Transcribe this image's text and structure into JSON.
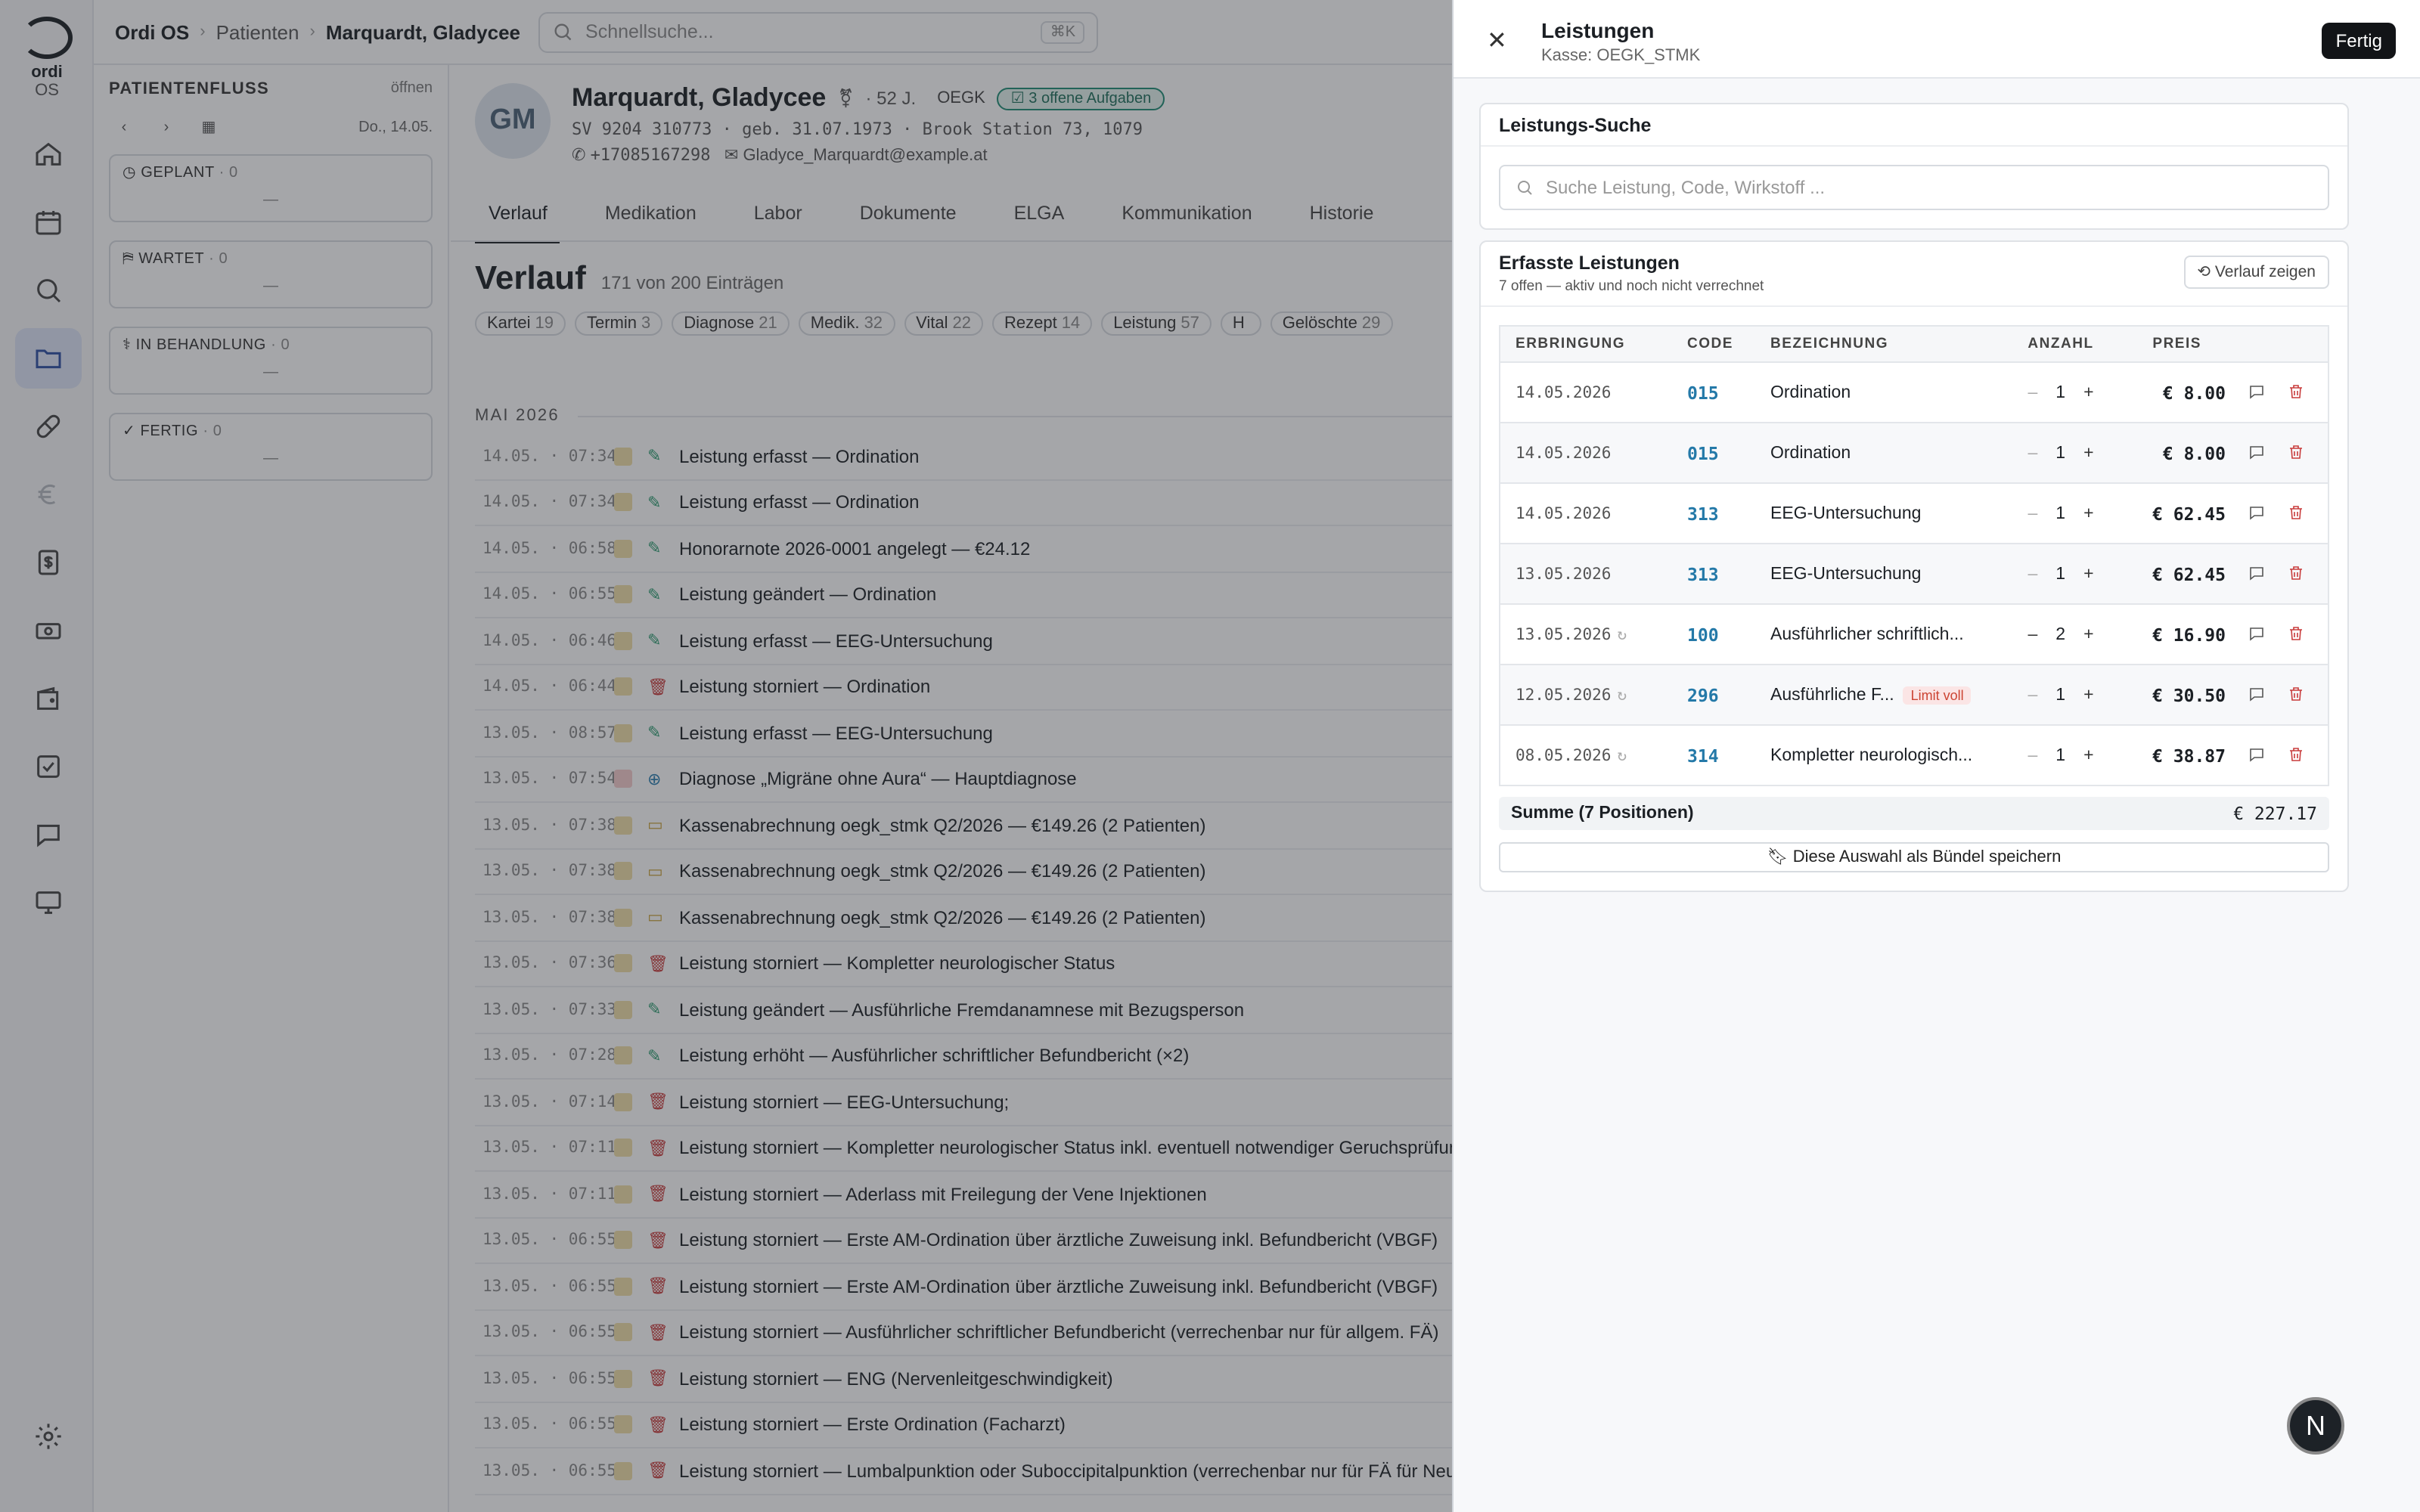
{
  "app": {
    "logo_text": "ordi",
    "logo_suffix": "OS",
    "name": "Ordi OS"
  },
  "breadcrumb": {
    "section": "Patienten",
    "current": "Marquardt, Gladycee"
  },
  "search": {
    "placeholder": "Schnellsuche...",
    "shortcut": "⌘K"
  },
  "rail_icons": [
    "home-icon",
    "calendar-icon",
    "search-icon",
    "folder-icon",
    "pill-icon",
    "euro-icon",
    "dollar-doc-icon",
    "banknote-icon",
    "wallet-icon",
    "checkbox-icon",
    "chat-icon",
    "monitor-icon",
    "gear-icon"
  ],
  "flow": {
    "title": "PATIENTENFLUSS",
    "open_label": "öffnen",
    "date": "Do., 14.05.",
    "boxes": [
      {
        "label": "GEPLANT",
        "count": "· 0",
        "empty": "—"
      },
      {
        "label": "WARTET",
        "count": "· 0",
        "empty": "—"
      },
      {
        "label": "IN BEHANDLUNG",
        "count": "· 0",
        "empty": "—"
      },
      {
        "label": "FERTIG",
        "count": "· 0",
        "empty": "—"
      }
    ]
  },
  "patient": {
    "initials": "GM",
    "name": "Marquardt, Gladycee",
    "meta": "· 52 J.",
    "insurance": "OEGK",
    "tasks": "3 offene Aufgaben",
    "line1": "SV 9204 310773 · geb. 31.07.1973 · Brook Station 73, 1079",
    "phone": "+17085167298",
    "email": "Gladyce_Marquardt@example.at"
  },
  "tabs": [
    "Verlauf",
    "Medikation",
    "Labor",
    "Dokumente",
    "ELGA",
    "Kommunikation",
    "Historie"
  ],
  "verlauf": {
    "title": "Verlauf",
    "count": "171 von 200 Einträgen",
    "chips": [
      {
        "label": "Kartei",
        "n": "19"
      },
      {
        "label": "Termin",
        "n": "3"
      },
      {
        "label": "Diagnose",
        "n": "21"
      },
      {
        "label": "Medik.",
        "n": "32"
      },
      {
        "label": "Vital",
        "n": "22"
      },
      {
        "label": "Rezept",
        "n": "14"
      },
      {
        "label": "Leistung",
        "n": "57"
      },
      {
        "label": "H",
        "n": ""
      },
      {
        "label": "Gelöschte",
        "n": "29"
      }
    ],
    "month": "MAI 2026",
    "entries": [
      {
        "ts": "14.05. · 07:34",
        "text": "Leistung erfasst — Ordination",
        "kind": "edit"
      },
      {
        "ts": "14.05. · 07:34",
        "text": "Leistung erfasst — Ordination",
        "kind": "edit"
      },
      {
        "ts": "14.05. · 06:58",
        "text": "Honorarnote 2026-0001 angelegt — €24.12",
        "kind": "edit"
      },
      {
        "ts": "14.05. · 06:55",
        "text": "Leistung geändert — Ordination",
        "kind": "edit"
      },
      {
        "ts": "14.05. · 06:46",
        "text": "Leistung erfasst — EEG-Untersuchung",
        "kind": "edit"
      },
      {
        "ts": "14.05. · 06:44",
        "text": "Leistung storniert — Ordination",
        "kind": "del"
      },
      {
        "ts": "13.05. · 08:57",
        "text": "Leistung erfasst — EEG-Untersuchung",
        "kind": "edit"
      },
      {
        "ts": "13.05. · 07:54",
        "text": "Diagnose „Migräne ohne Aura“ — Hauptdiagnose",
        "kind": "diag"
      },
      {
        "ts": "13.05. · 07:38",
        "text": "Kassenabrechnung oegk_stmk Q2/2026 — €149.26 (2 Patienten)",
        "kind": "bill"
      },
      {
        "ts": "13.05. · 07:38",
        "text": "Kassenabrechnung oegk_stmk Q2/2026 — €149.26 (2 Patienten)",
        "kind": "bill"
      },
      {
        "ts": "13.05. · 07:38",
        "text": "Kassenabrechnung oegk_stmk Q2/2026 — €149.26 (2 Patienten)",
        "kind": "bill"
      },
      {
        "ts": "13.05. · 07:36",
        "text": "Leistung storniert — Kompletter neurologischer Status",
        "kind": "del"
      },
      {
        "ts": "13.05. · 07:33",
        "text": "Leistung geändert — Ausführliche Fremdanamnese mit Bezugsperson",
        "kind": "edit"
      },
      {
        "ts": "13.05. · 07:28",
        "text": "Leistung erhöht — Ausführlicher schriftlicher Befundbericht (×2)",
        "kind": "edit"
      },
      {
        "ts": "13.05. · 07:14",
        "text": "Leistung storniert — EEG-Untersuchung;",
        "kind": "del"
      },
      {
        "ts": "13.05. · 07:11",
        "text": "Leistung storniert — Kompletter neurologischer Status inkl. eventuell notwendiger Geruchsprüfung",
        "kind": "del"
      },
      {
        "ts": "13.05. · 07:11",
        "text": "Leistung storniert — Aderlass mit Freilegung der Vene Injektionen",
        "kind": "del"
      },
      {
        "ts": "13.05. · 06:55",
        "text": "Leistung storniert — Erste AM-Ordination über ärztliche Zuweisung inkl. Befundbericht (VBGF)",
        "kind": "del"
      },
      {
        "ts": "13.05. · 06:55",
        "text": "Leistung storniert — Erste AM-Ordination über ärztliche Zuweisung inkl. Befundbericht (VBGF)",
        "kind": "del"
      },
      {
        "ts": "13.05. · 06:55",
        "text": "Leistung storniert — Ausführlicher schriftlicher Befundbericht (verrechenbar nur für allgem. FÄ)",
        "kind": "del"
      },
      {
        "ts": "13.05. · 06:55",
        "text": "Leistung storniert — ENG (Nervenleitgeschwindigkeit)",
        "kind": "del"
      },
      {
        "ts": "13.05. · 06:55",
        "text": "Leistung storniert — Erste Ordination (Facharzt)",
        "kind": "del"
      },
      {
        "ts": "13.05. · 06:55",
        "text": "Leistung storniert — Lumbalpunktion oder Suboccipitalpunktion (verrechenbar nur für FÄ für Neurologie)",
        "kind": "del"
      }
    ]
  },
  "panel": {
    "title": "Leistungen",
    "subtitle": "Kasse: OEGK_STMK",
    "done": "Fertig",
    "search_title": "Leistungs-Suche",
    "search_placeholder": "Suche Leistung, Code, Wirkstoff ...",
    "list_title": "Erfasste Leistungen",
    "list_sub": "7 offen — aktiv und noch nicht verrechnet",
    "history_btn": "Verlauf zeigen",
    "columns": [
      "ERBRINGUNG",
      "CODE",
      "BEZEICHNUNG",
      "ANZAHL",
      "PREIS"
    ],
    "rows": [
      {
        "date": "14.05.2026",
        "rep": "",
        "code": "015",
        "name": "Ordination",
        "limit": "",
        "qty": "1",
        "price": "€ 8.00"
      },
      {
        "date": "14.05.2026",
        "rep": "",
        "code": "015",
        "name": "Ordination",
        "limit": "",
        "qty": "1",
        "price": "€ 8.00"
      },
      {
        "date": "14.05.2026",
        "rep": "",
        "code": "313",
        "name": "EEG-Untersuchung",
        "limit": "",
        "qty": "1",
        "price": "€ 62.45"
      },
      {
        "date": "13.05.2026",
        "rep": "",
        "code": "313",
        "name": "EEG-Untersuchung",
        "limit": "",
        "qty": "1",
        "price": "€ 62.45"
      },
      {
        "date": "13.05.2026",
        "rep": "↻",
        "code": "100",
        "name": "Ausführlicher schriftlich...",
        "limit": "",
        "qty": "2",
        "price": "€ 16.90"
      },
      {
        "date": "12.05.2026",
        "rep": "↻",
        "code": "296",
        "name": "Ausführliche F...",
        "limit": "Limit voll",
        "qty": "1",
        "price": "€ 30.50"
      },
      {
        "date": "08.05.2026",
        "rep": "↻",
        "code": "314",
        "name": "Kompletter neurologisch...",
        "limit": "",
        "qty": "1",
        "price": "€ 38.87"
      }
    ],
    "sum_label": "Summe (7 Positionen)",
    "sum_value": "€ 227.17",
    "bundle_label": "Diese Auswahl als Bündel speichern"
  },
  "fab": "N",
  "colors": {
    "accent": "#2b4ea2",
    "code": "#2479a8",
    "danger": "#c83b3b",
    "tasks": "#1e8c74"
  }
}
